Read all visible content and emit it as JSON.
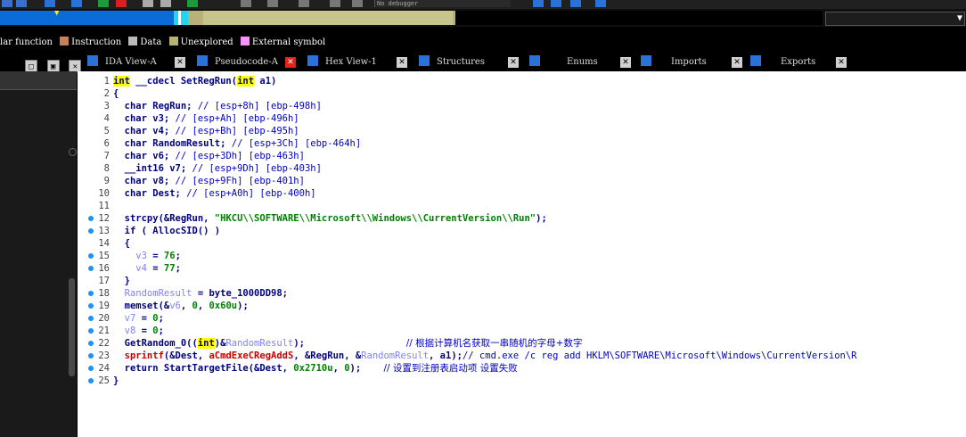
{
  "toolbar": {
    "debugger_select": "No debugger"
  },
  "legend": [
    {
      "label": "lar function",
      "color": "#c98258"
    },
    {
      "label": "Instruction",
      "color": "#bbbbbb"
    },
    {
      "label": "Data",
      "color": "#b7b473"
    },
    {
      "label": "Unexplored",
      "color": "#ff90ff"
    },
    {
      "label": "External symbol",
      "color": ""
    }
  ],
  "window_controls": [
    "□",
    "▣",
    "✕"
  ],
  "tabs": [
    {
      "label": "IDA View-A",
      "icon_color": "#2a72d8",
      "active": false
    },
    {
      "label": "Pseudocode-A",
      "icon_color": "#2a72d8",
      "active": true
    },
    {
      "label": "Hex View-1",
      "icon_color": "#2a72d8",
      "active": false
    },
    {
      "label": "Structures",
      "icon_color": "#2a72d8",
      "active": false
    },
    {
      "label": "Enums",
      "icon_color": "#2a72d8",
      "active": false
    },
    {
      "label": "Imports",
      "icon_color": "#2a72d8",
      "active": false
    },
    {
      "label": "Exports",
      "icon_color": "#2a72d8",
      "active": false
    }
  ],
  "tab_close_glyph": "✕",
  "code": {
    "lines": [
      {
        "n": "1",
        "bp": false,
        "parts": [
          [
            "hl",
            "int"
          ],
          [
            "kw",
            " __cdecl SetRegRun("
          ],
          [
            "hl",
            "int"
          ],
          [
            "kw",
            " a1)"
          ]
        ]
      },
      {
        "n": "2",
        "bp": false,
        "parts": [
          [
            "kw",
            "{"
          ]
        ]
      },
      {
        "n": "3",
        "bp": false,
        "parts": [
          [
            "kw",
            "  char RegRun; "
          ],
          [
            "cmt",
            "// [esp+8h] [ebp-498h]"
          ]
        ]
      },
      {
        "n": "4",
        "bp": false,
        "parts": [
          [
            "kw",
            "  char v3; "
          ],
          [
            "cmt",
            "// [esp+Ah] [ebp-496h]"
          ]
        ]
      },
      {
        "n": "5",
        "bp": false,
        "parts": [
          [
            "kw",
            "  char v4; "
          ],
          [
            "cmt",
            "// [esp+Bh] [ebp-495h]"
          ]
        ]
      },
      {
        "n": "6",
        "bp": false,
        "parts": [
          [
            "kw",
            "  char RandomResult; "
          ],
          [
            "cmt",
            "// [esp+3Ch] [ebp-464h]"
          ]
        ]
      },
      {
        "n": "7",
        "bp": false,
        "parts": [
          [
            "kw",
            "  char v6; "
          ],
          [
            "cmt",
            "// [esp+3Dh] [ebp-463h]"
          ]
        ]
      },
      {
        "n": "8",
        "bp": false,
        "parts": [
          [
            "kw",
            "  __int16 v7; "
          ],
          [
            "cmt",
            "// [esp+9Dh] [ebp-403h]"
          ]
        ]
      },
      {
        "n": "9",
        "bp": false,
        "parts": [
          [
            "kw",
            "  char v8; "
          ],
          [
            "cmt",
            "// [esp+9Fh] [ebp-401h]"
          ]
        ]
      },
      {
        "n": "10",
        "bp": false,
        "parts": [
          [
            "kw",
            "  char Dest; "
          ],
          [
            "cmt",
            "// [esp+A0h] [ebp-400h]"
          ]
        ]
      },
      {
        "n": "11",
        "bp": false,
        "parts": []
      },
      {
        "n": "12",
        "bp": true,
        "parts": [
          [
            "kw",
            "  strcpy(&RegRun, "
          ],
          [
            "str",
            "\"HKCU\\\\SOFTWARE\\\\Microsoft\\\\Windows\\\\CurrentVersion\\\\Run\""
          ],
          [
            "kw",
            ");"
          ]
        ]
      },
      {
        "n": "13",
        "bp": true,
        "parts": [
          [
            "kw",
            "  if ( AllocSID() )"
          ]
        ]
      },
      {
        "n": "14",
        "bp": false,
        "parts": [
          [
            "kw",
            "  {"
          ]
        ]
      },
      {
        "n": "15",
        "bp": true,
        "parts": [
          [
            "var",
            "    v3"
          ],
          [
            "kw",
            " = "
          ],
          [
            "num",
            "76"
          ],
          [
            "kw",
            ";"
          ]
        ]
      },
      {
        "n": "16",
        "bp": true,
        "parts": [
          [
            "var",
            "    v4"
          ],
          [
            "kw",
            " = "
          ],
          [
            "num",
            "77"
          ],
          [
            "kw",
            ";"
          ]
        ]
      },
      {
        "n": "17",
        "bp": false,
        "parts": [
          [
            "kw",
            "  }"
          ]
        ]
      },
      {
        "n": "18",
        "bp": true,
        "parts": [
          [
            "var",
            "  RandomResult"
          ],
          [
            "kw",
            " = byte_1000DD98;"
          ]
        ]
      },
      {
        "n": "19",
        "bp": true,
        "parts": [
          [
            "kw",
            "  memset(&"
          ],
          [
            "var",
            "v6"
          ],
          [
            "kw",
            ", "
          ],
          [
            "num",
            "0"
          ],
          [
            "kw",
            ", "
          ],
          [
            "num",
            "0x60u"
          ],
          [
            "kw",
            ");"
          ]
        ]
      },
      {
        "n": "20",
        "bp": true,
        "parts": [
          [
            "var",
            "  v7"
          ],
          [
            "kw",
            " = "
          ],
          [
            "num",
            "0"
          ],
          [
            "kw",
            ";"
          ]
        ]
      },
      {
        "n": "21",
        "bp": true,
        "parts": [
          [
            "var",
            "  v8"
          ],
          [
            "kw",
            " = "
          ],
          [
            "num",
            "0"
          ],
          [
            "kw",
            ";"
          ]
        ]
      },
      {
        "n": "22",
        "bp": true,
        "parts": [
          [
            "kw",
            "  GetRandom_0(("
          ],
          [
            "hl",
            "int"
          ],
          [
            "kw",
            ")&"
          ],
          [
            "var",
            "RandomResult"
          ],
          [
            "kw",
            ");                  "
          ],
          [
            "cmtzh",
            "// 根据计算机名获取一串随机的字母+数字"
          ]
        ]
      },
      {
        "n": "23",
        "bp": true,
        "parts": [
          [
            "fn-red",
            "  sprintf"
          ],
          [
            "kw",
            "(&Dest, "
          ],
          [
            "fn-red",
            "aCmdExeCRegAddS"
          ],
          [
            "kw",
            ", &RegRun, &"
          ],
          [
            "var",
            "RandomResult"
          ],
          [
            "kw",
            ", a1);"
          ],
          [
            "cmt",
            "// cmd.exe /c reg add HKLM\\SOFTWARE\\Microsoft\\Windows\\CurrentVersion\\R"
          ]
        ]
      },
      {
        "n": "24",
        "bp": true,
        "parts": [
          [
            "kw",
            "  return StartTargetFile(&Dest, "
          ],
          [
            "num",
            "0x2710u"
          ],
          [
            "kw",
            ", "
          ],
          [
            "num",
            "0"
          ],
          [
            "kw",
            ");    "
          ],
          [
            "cmtzh",
            "// 设置到注册表启动项 设置失败"
          ]
        ]
      },
      {
        "n": "25",
        "bp": true,
        "parts": [
          [
            "kw",
            "}"
          ]
        ]
      }
    ]
  }
}
